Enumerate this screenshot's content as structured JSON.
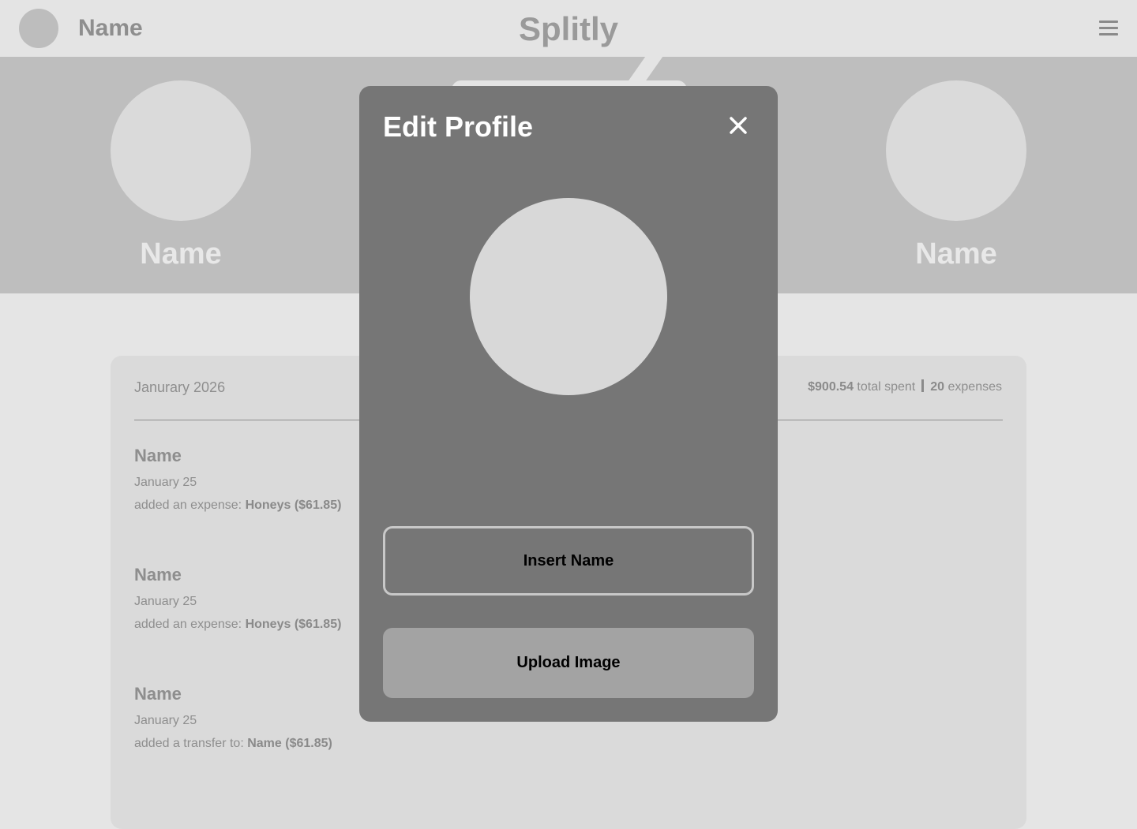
{
  "topbar": {
    "user_name": "Name",
    "brand": "Splitly",
    "menu_icon": "hamburger-menu-icon"
  },
  "banner": {
    "members": [
      {
        "name": "Name"
      },
      {
        "name": "Name"
      }
    ]
  },
  "activity": {
    "month": "Janurary 2026",
    "total_spent": "$900.54",
    "total_spent_label": "total spent",
    "expense_count": "20",
    "expense_count_label": "expenses",
    "items": [
      {
        "name": "Name",
        "date": "January 25",
        "action": "added an expense:",
        "detail": "Honeys ($61.85)"
      },
      {
        "name": "Name",
        "date": "January 25",
        "action": "added an expense:",
        "detail": "Honeys ($61.85)"
      },
      {
        "name": "Name",
        "date": "January 25",
        "action": "added a transfer to:",
        "detail": "Name ($61.85)"
      }
    ]
  },
  "modal": {
    "title": "Edit Profile",
    "close_icon": "close-icon",
    "name_placeholder": "Insert Name",
    "upload_label": "Upload Image"
  },
  "colors": {
    "page_bg": "#e5e5e5",
    "banner_bg": "#bebebe",
    "modal_bg": "#767676",
    "upload_button_bg": "#a3a3a3",
    "avatar_fill": "#d8d8d8"
  }
}
